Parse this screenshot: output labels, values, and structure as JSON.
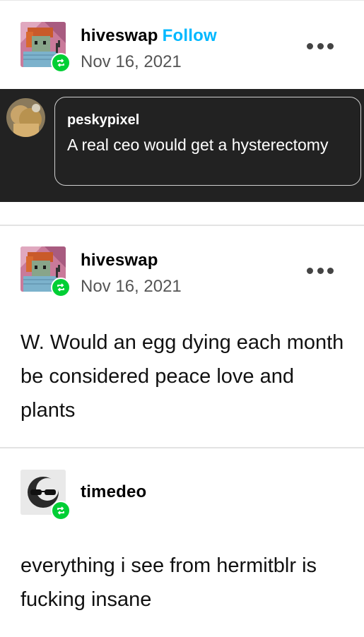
{
  "posts": [
    {
      "username": "hiveswap",
      "follow_label": "Follow",
      "date": "Nov 16, 2021",
      "avatar_icon": "pixel-character-avatar",
      "badge_icon": "reblog-icon",
      "more_icon": "more-options-icon"
    },
    {
      "username": "hiveswap",
      "date": "Nov 16, 2021",
      "avatar_icon": "pixel-character-avatar",
      "badge_icon": "reblog-icon",
      "more_icon": "more-options-icon",
      "body": "W. Would an egg dying each month be considered peace love and plants"
    },
    {
      "username": "timedeo",
      "avatar_icon": "sunglasses-moon-avatar",
      "badge_icon": "reblog-icon",
      "body": "everything i see from hermitblr is fucking insane"
    }
  ],
  "ask": {
    "asker": "peskypixel",
    "text": "A real ceo would get a hysterectomy",
    "avatar_icon": "cat-avatar"
  },
  "colors": {
    "accent_follow": "#00b8ff",
    "reblog_green": "#00cf35",
    "ask_background": "#222222"
  }
}
